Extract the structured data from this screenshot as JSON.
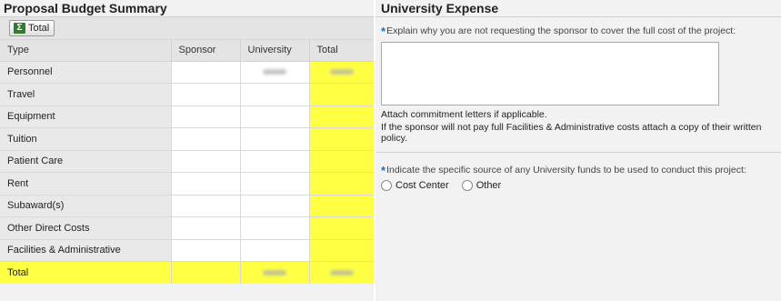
{
  "budget_summary": {
    "title": "Proposal Budget Summary",
    "total_button_label": "Total",
    "columns": [
      "Type",
      "Sponsor",
      "University",
      "Total"
    ],
    "rows": [
      {
        "type": "Personnel",
        "sponsor": "",
        "university": "",
        "total": ""
      },
      {
        "type": "Travel",
        "sponsor": "",
        "university": "",
        "total": ""
      },
      {
        "type": "Equipment",
        "sponsor": "",
        "university": "",
        "total": ""
      },
      {
        "type": "Tuition",
        "sponsor": "",
        "university": "",
        "total": ""
      },
      {
        "type": "Patient Care",
        "sponsor": "",
        "university": "",
        "total": ""
      },
      {
        "type": "Rent",
        "sponsor": "",
        "university": "",
        "total": ""
      },
      {
        "type": "Subaward(s)",
        "sponsor": "",
        "university": "",
        "total": ""
      },
      {
        "type": "Other Direct Costs",
        "sponsor": "",
        "university": "",
        "total": ""
      },
      {
        "type": "Facilities & Administrative",
        "sponsor": "",
        "university": "",
        "total": ""
      }
    ],
    "total_row_label": "Total",
    "highlight_color": "#ffff44"
  },
  "university_expense": {
    "title": "University Expense",
    "required_marker": "*",
    "explain_question": "Explain why you are not requesting the sponsor to cover the full cost of the project:",
    "explain_value": "",
    "attach_note": "Attach commitment letters if applicable.",
    "fa_note": "If the sponsor will not pay full Facilities & Administrative costs attach a copy of their written policy.",
    "source_question": "Indicate the specific source of any University funds to be used to conduct this project:",
    "source_options": [
      "Cost Center",
      "Other"
    ]
  },
  "icons": {
    "total_button_icon": "sigma-sum-icon"
  }
}
